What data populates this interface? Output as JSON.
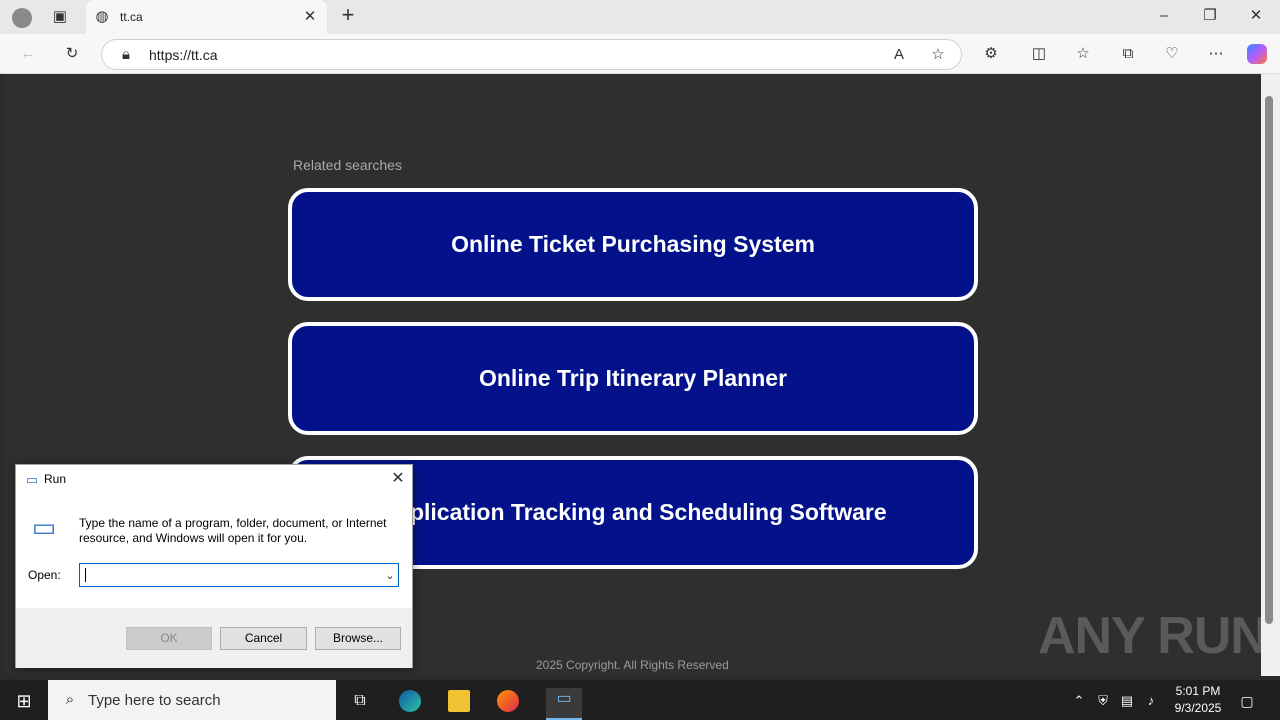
{
  "browser": {
    "tab_title": "tt.ca",
    "url": "https://tt.ca"
  },
  "page": {
    "related_label": "Related searches",
    "buttons": [
      "Online Ticket Purchasing System",
      "Online Trip Itinerary Planner",
      "Application Tracking and Scheduling Software"
    ],
    "copyright": "2025 Copyright. All Rights Reserved",
    "watermark": "ANY RUN"
  },
  "run_dialog": {
    "title": "Run",
    "message": "Type the name of a program, folder, document, or Internet resource, and Windows will open it for you.",
    "open_label": "Open:",
    "open_value": "",
    "ok": "OK",
    "cancel": "Cancel",
    "browse": "Browse..."
  },
  "taskbar": {
    "search_placeholder": "Type here to search",
    "time": "5:01 PM",
    "date": "9/3/2025"
  },
  "colors": {
    "button_bg": "#03128a",
    "page_bg": "#2f2f2f"
  }
}
